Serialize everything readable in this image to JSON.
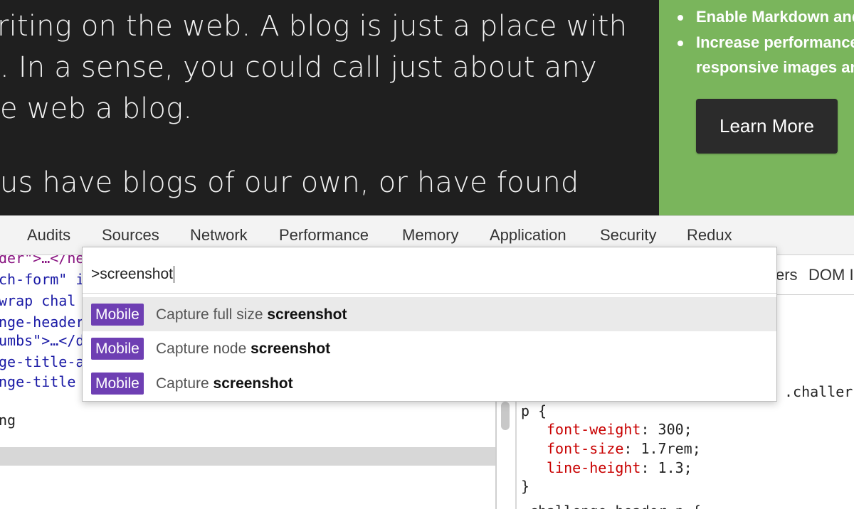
{
  "article": {
    "lines": [
      "riting on the web. A blog is just a place with",
      ". In a sense, you could call just about any",
      "e web a blog.",
      "us have blogs of our own, or have found"
    ]
  },
  "promo": {
    "bullets": [
      "Enable Markdown and",
      "Increase performance",
      "responsive images and"
    ],
    "button_label": "Learn More"
  },
  "devtools": {
    "tabs": [
      "Audits",
      "Sources",
      "Network",
      "Performance",
      "Memory",
      "Application",
      "Security",
      "Redux"
    ],
    "elements": {
      "lines": [
        {
          "tag": "der\">…</ne",
          "note": ""
        },
        {
          "tag": "ch-form\" i",
          "note": ""
        },
        {
          "tag": "wrap chal",
          "note": ""
        },
        {
          "tag": "nge-header",
          "note": ""
        },
        {
          "tag": "umbs\">…</d",
          "note": ""
        },
        {
          "tag": "ge-title-a",
          "note": ""
        },
        {
          "tag": "nge-title",
          "note": ""
        },
        {
          "tag": "ng",
          "note": ""
        }
      ]
    },
    "styles": {
      "subtabs": [
        "ers",
        "DOM I"
      ],
      "selector_fragment": ".challer",
      "selector": "p {",
      "declarations": [
        {
          "prop": "font-weight",
          "value": "300;"
        },
        {
          "prop": "font-size",
          "value": "1.7rem;"
        },
        {
          "prop": "line-height",
          "value": "1.3;"
        }
      ],
      "close": "}",
      "next_rule": ".challenge-header p {"
    }
  },
  "palette": {
    "query": ">screenshot",
    "results": [
      {
        "badge": "Mobile",
        "prefix": "Capture full size ",
        "match": "screenshot"
      },
      {
        "badge": "Mobile",
        "prefix": "Capture node ",
        "match": "screenshot"
      },
      {
        "badge": "Mobile",
        "prefix": "Capture ",
        "match": "screenshot"
      }
    ]
  },
  "colors": {
    "page_bg": "#1f1f1f",
    "promo_bg": "#7ab55c",
    "badge": "#6e3fb3"
  }
}
